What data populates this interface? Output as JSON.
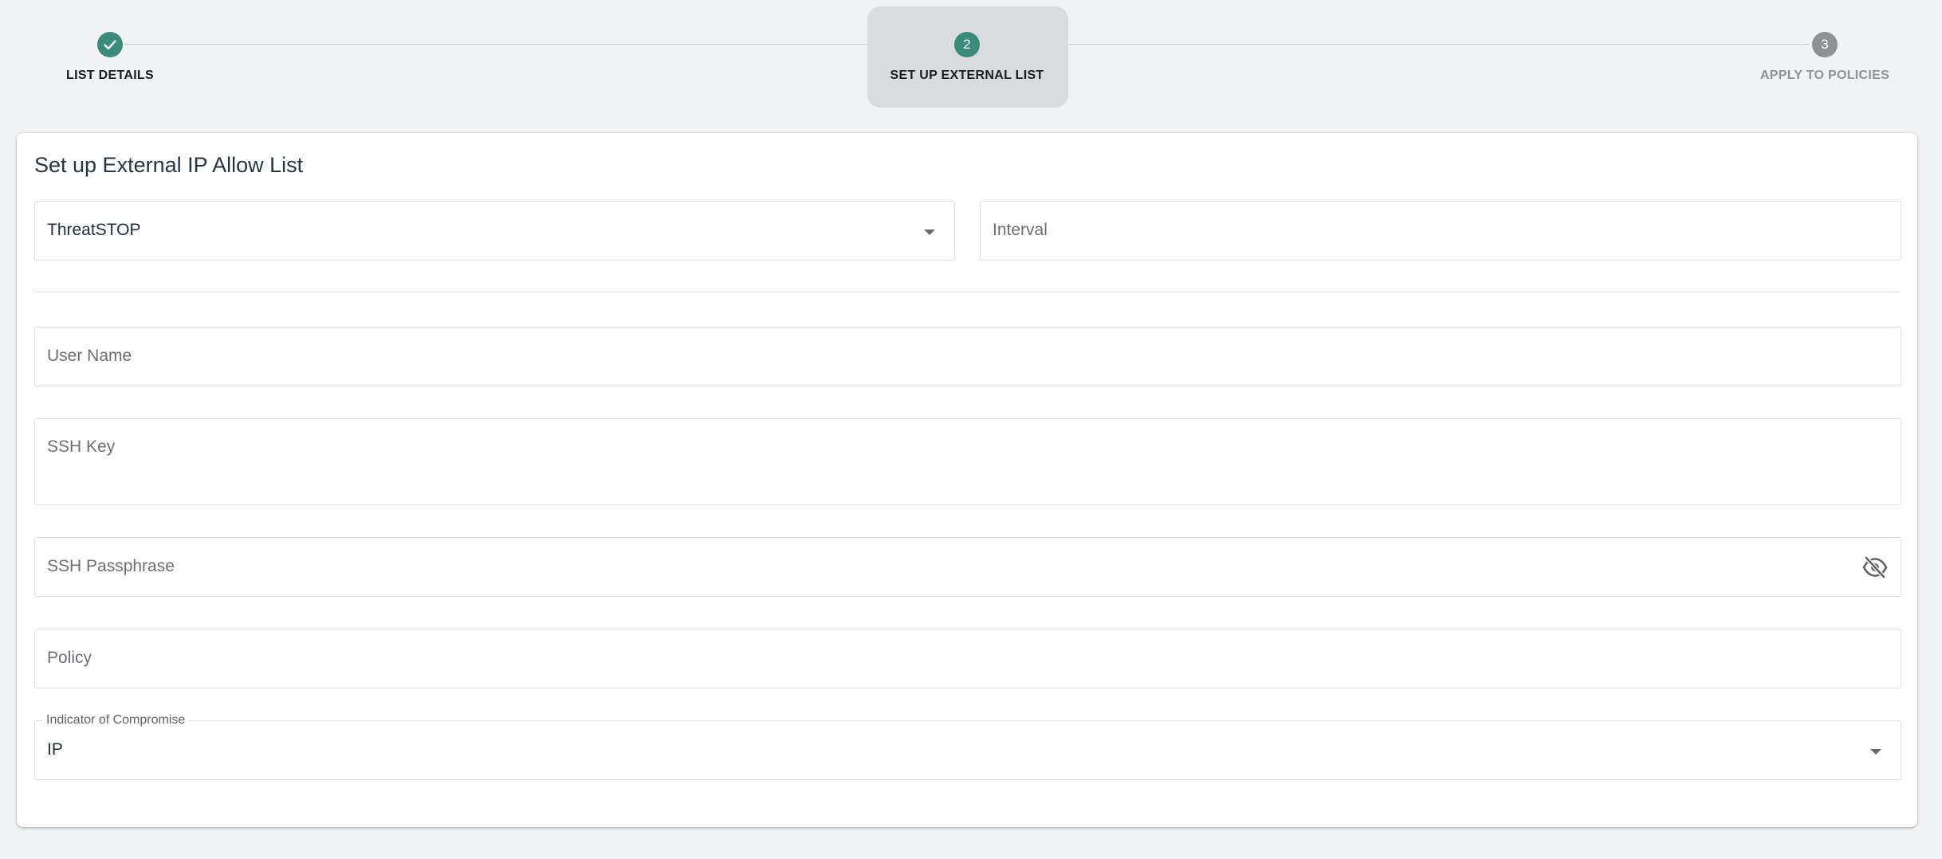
{
  "stepper": {
    "steps": [
      {
        "number": "1",
        "label": "LIST DETAILS",
        "state": "done"
      },
      {
        "number": "2",
        "label": "SET UP EXTERNAL LIST",
        "state": "active"
      },
      {
        "number": "3",
        "label": "APPLY TO POLICIES",
        "state": "pending"
      }
    ]
  },
  "form": {
    "title": "Set up External IP Allow List",
    "provider": {
      "value": "ThreatSTOP"
    },
    "interval": {
      "placeholder": "Interval"
    },
    "user_name": {
      "placeholder": "User Name"
    },
    "ssh_key": {
      "placeholder": "SSH Key"
    },
    "ssh_passphrase": {
      "placeholder": "SSH Passphrase",
      "icon": "eye-off-icon"
    },
    "policy": {
      "placeholder": "Policy"
    },
    "ioc": {
      "label": "Indicator of Compromise",
      "value": "IP"
    }
  },
  "colors": {
    "accent": "#3a8b7a",
    "pending": "#8f9194",
    "background": "#f1f2f4"
  }
}
